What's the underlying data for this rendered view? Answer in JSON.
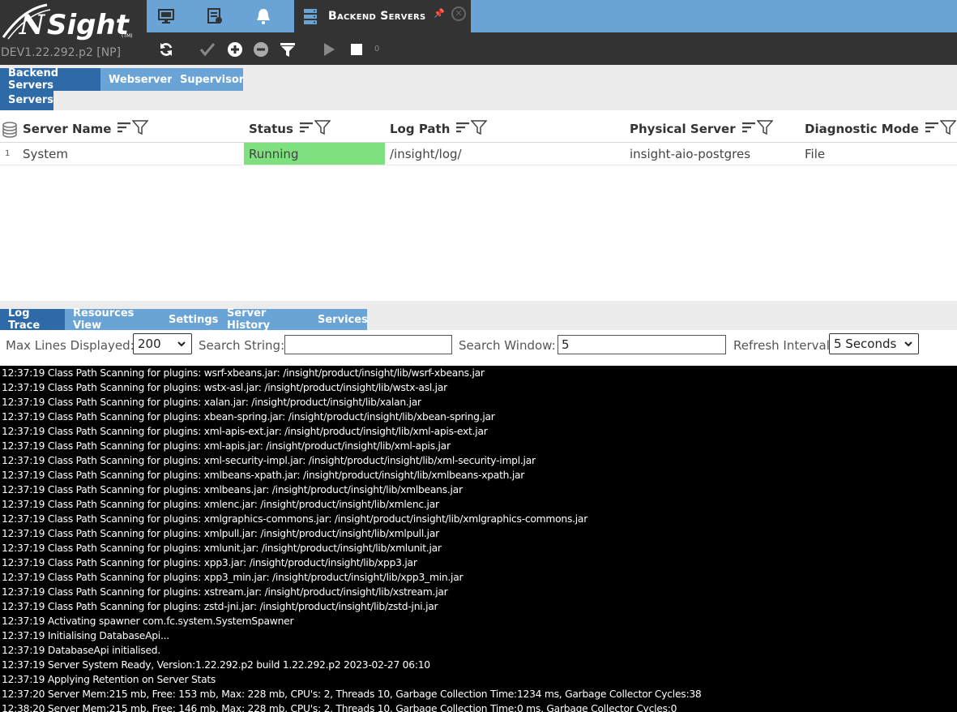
{
  "app": {
    "logo_text": "NSight",
    "version": "DEV1.22.292.p2 [NP]"
  },
  "nav_tabs": [
    {
      "icon": "monitor-icon"
    },
    {
      "icon": "report-icon"
    },
    {
      "icon": "bell-icon"
    },
    {
      "icon": "server-icon",
      "label": "Backend Servers",
      "active": true
    }
  ],
  "toolbar": {
    "icons": [
      "refresh-icon",
      "check-icon",
      "add-icon",
      "remove-icon",
      "filter-icon",
      "play-icon",
      "stop-icon"
    ],
    "count": "0"
  },
  "sub_tabs": {
    "row1": [
      "Backend Servers",
      "Webserver",
      "Supervisor"
    ],
    "row2": [
      "Servers"
    ]
  },
  "grid": {
    "columns": [
      "Server Name",
      "Status",
      "Log Path",
      "Physical Server",
      "Diagnostic Mode"
    ],
    "rows": [
      {
        "num": "1",
        "server_name": "System",
        "status": "Running",
        "log_path": "/insight/log/",
        "physical_server": "insight-aio-postgres",
        "diagnostic_mode": "File"
      }
    ]
  },
  "bottom_tabs": [
    "Log Trace",
    "Resources View",
    "Settings",
    "Server History",
    "Services"
  ],
  "controls": {
    "max_lines_label": "Max Lines Displayed:",
    "max_lines_value": "200",
    "search_string_label": "Search String:",
    "search_string_value": "",
    "search_window_label": "Search Window:",
    "search_window_value": "5",
    "refresh_label": "Refresh Interval",
    "refresh_value": "5 Seconds"
  },
  "log_lines": [
    "12:37:19 Class Path Scanning for plugins: wsrf-xbeans.jar: /insight/product/insight/lib/wsrf-xbeans.jar",
    "12:37:19 Class Path Scanning for plugins: wstx-asl.jar: /insight/product/insight/lib/wstx-asl.jar",
    "12:37:19 Class Path Scanning for plugins: xalan.jar: /insight/product/insight/lib/xalan.jar",
    "12:37:19 Class Path Scanning for plugins: xbean-spring.jar: /insight/product/insight/lib/xbean-spring.jar",
    "12:37:19 Class Path Scanning for plugins: xml-apis-ext.jar: /insight/product/insight/lib/xml-apis-ext.jar",
    "12:37:19 Class Path Scanning for plugins: xml-apis.jar: /insight/product/insight/lib/xml-apis.jar",
    "12:37:19 Class Path Scanning for plugins: xml-security-impl.jar: /insight/product/insight/lib/xml-security-impl.jar",
    "12:37:19 Class Path Scanning for plugins: xmlbeans-xpath.jar: /insight/product/insight/lib/xmlbeans-xpath.jar",
    "12:37:19 Class Path Scanning for plugins: xmlbeans.jar: /insight/product/insight/lib/xmlbeans.jar",
    "12:37:19 Class Path Scanning for plugins: xmlenc.jar: /insight/product/insight/lib/xmlenc.jar",
    "12:37:19 Class Path Scanning for plugins: xmlgraphics-commons.jar: /insight/product/insight/lib/xmlgraphics-commons.jar",
    "12:37:19 Class Path Scanning for plugins: xmlpull.jar: /insight/product/insight/lib/xmlpull.jar",
    "12:37:19 Class Path Scanning for plugins: xmlunit.jar: /insight/product/insight/lib/xmlunit.jar",
    "12:37:19 Class Path Scanning for plugins: xpp3.jar: /insight/product/insight/lib/xpp3.jar",
    "12:37:19 Class Path Scanning for plugins: xpp3_min.jar: /insight/product/insight/lib/xpp3_min.jar",
    "12:37:19 Class Path Scanning for plugins: xstream.jar: /insight/product/insight/lib/xstream.jar",
    "12:37:19 Class Path Scanning for plugins: zstd-jni.jar: /insight/product/insight/lib/zstd-jni.jar",
    "12:37:19 Activating spawner com.fc.system.SystemSpawner",
    "12:37:19 Initialising DatabaseApi...",
    "12:37:19 DatabaseApi initialised.",
    "12:37:19 Server System Ready, Version:1.22.292.p2 build 1.22.292.p2 2023-02-27 06:10",
    "12:37:19 Applying Retention on Server Stats",
    "12:37:20 Server Mem:215 mb, Free: 153 mb, Max: 228 mb, CPU's: 2, Threads 10, Garbage Collection Time:1234 ms, Garbage Collector Cycles:38",
    "12:38:20 Server Mem:215 mb, Free: 146 mb, Max: 228 mb, CPU's: 2, Threads 10, Garbage Collection Time:0 ms, Garbage Collector Cycles:0"
  ],
  "colors": {
    "header_dark": "#333333",
    "tab_blue": "#6aa3d5",
    "tab_active": "#2e6aa8",
    "status_running": "#7ee07e",
    "log_bg": "#000000"
  }
}
